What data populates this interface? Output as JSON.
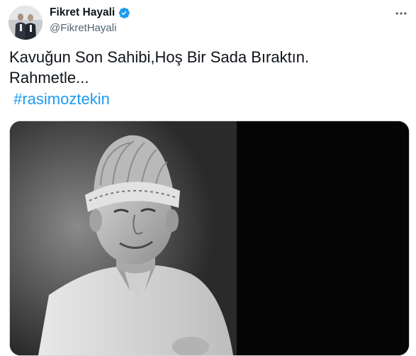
{
  "author": {
    "display_name": "Fikret Hayali",
    "handle": "@FikretHayali",
    "verified": true,
    "verified_icon": "verified-badge-icon"
  },
  "menu": {
    "icon": "more-options-icon"
  },
  "tweet": {
    "line1": "Kavuğun Son Sahibi,Hoş Bir Sada Bıraktın.",
    "line2": "Rahmetle...",
    "hashtag": "#rasimoztekin"
  },
  "media": {
    "description_icon": "photo-portrait",
    "style": "black-and-white"
  },
  "colors": {
    "text": "#0f1419",
    "secondary": "#536471",
    "link": "#1d9bf0",
    "verified": "#1d9bf0",
    "border": "#cfd9de"
  }
}
